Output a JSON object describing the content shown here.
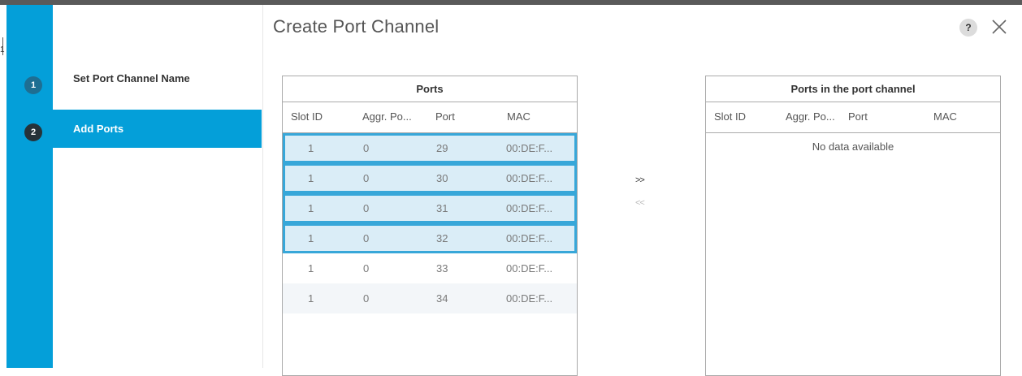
{
  "dialog": {
    "title": "Create Port Channel",
    "help_label": "?"
  },
  "steps": [
    {
      "number": "1",
      "label": "Set Port Channel Name"
    },
    {
      "number": "2",
      "label": "Add Ports"
    }
  ],
  "ports_table": {
    "title": "Ports",
    "columns": [
      "Slot ID",
      "Aggr. Po...",
      "Port",
      "MAC"
    ],
    "rows": [
      {
        "slot": "1",
        "aggr": "0",
        "port": "29",
        "mac": "00:DE:F...",
        "selected": true
      },
      {
        "slot": "1",
        "aggr": "0",
        "port": "30",
        "mac": "00:DE:F...",
        "selected": true
      },
      {
        "slot": "1",
        "aggr": "0",
        "port": "31",
        "mac": "00:DE:F...",
        "selected": true
      },
      {
        "slot": "1",
        "aggr": "0",
        "port": "32",
        "mac": "00:DE:F...",
        "selected": true
      },
      {
        "slot": "1",
        "aggr": "0",
        "port": "33",
        "mac": "00:DE:F...",
        "selected": false
      },
      {
        "slot": "1",
        "aggr": "0",
        "port": "34",
        "mac": "00:DE:F...",
        "selected": false
      }
    ]
  },
  "channel_table": {
    "title": "Ports in the port channel",
    "columns": [
      "Slot ID",
      "Aggr. Po...",
      "Port",
      "MAC"
    ],
    "empty_text": "No data available"
  },
  "move_buttons": {
    "add": ">>",
    "remove": "<<"
  },
  "edge_label": "1",
  "colors": {
    "accent": "#049fd9",
    "selected_row": "#daedf7",
    "selected_border": "#37a7d9"
  }
}
